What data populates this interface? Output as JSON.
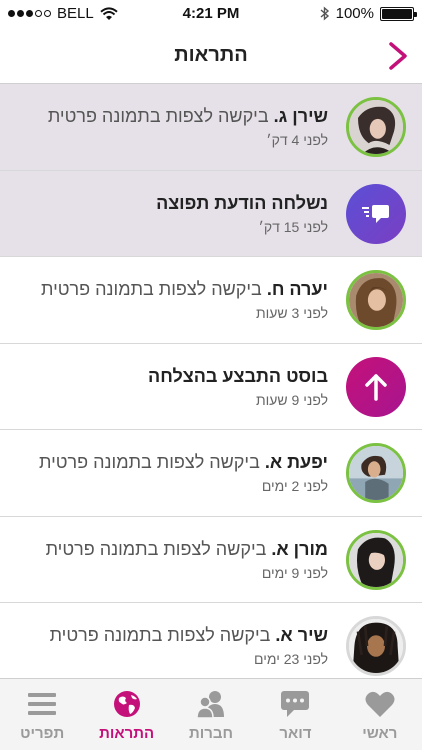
{
  "status_bar": {
    "carrier": "BELL",
    "time": "4:21 PM",
    "battery": "100%",
    "battery_level": 1.0,
    "signal_bars": 3,
    "signal_total": 5
  },
  "header": {
    "title": "התראות"
  },
  "notifications": [
    {
      "name": "שירן ג.",
      "message": " ביקשה לצפות בתמונה פרטית",
      "time": "לפני 4 דק׳",
      "kind": "photo",
      "unread": true
    },
    {
      "name": "",
      "message": "נשלחה הודעת תפוצה",
      "time": "לפני 15 דק׳",
      "kind": "broadcast",
      "unread": true
    },
    {
      "name": "יערה ח.",
      "message": " ביקשה לצפות בתמונה פרטית",
      "time": "לפני 3 שעות",
      "kind": "photo",
      "unread": false
    },
    {
      "name": "",
      "message": "בוסט התבצע בהצלחה",
      "time": "לפני 9 שעות",
      "kind": "boost",
      "unread": false
    },
    {
      "name": "יפעת א.",
      "message": " ביקשה לצפות בתמונה פרטית",
      "time": "לפני 2 ימים",
      "kind": "photo",
      "unread": false
    },
    {
      "name": "מורן א.",
      "message": " ביקשה לצפות בתמונה פרטית",
      "time": "לפני 9 ימים",
      "kind": "photo",
      "unread": false
    },
    {
      "name": "שיר א.",
      "message": " ביקשה לצפות בתמונה פרטית",
      "time": "לפני 23 ימים",
      "kind": "photo",
      "unread": false
    }
  ],
  "tabs": [
    {
      "label": "תפריט",
      "icon": "menu-icon",
      "active": false
    },
    {
      "label": "התראות",
      "icon": "globe-icon",
      "active": true
    },
    {
      "label": "חברות",
      "icon": "friends-icon",
      "active": false
    },
    {
      "label": "דואר",
      "icon": "mail-icon",
      "active": false
    },
    {
      "label": "ראשי",
      "icon": "heart-icon",
      "active": false
    }
  ],
  "colors": {
    "accent": "#c4117a",
    "avatar_ring": "#7bc142",
    "unread_bg": "#e6e1e8",
    "tab_inactive": "#9a9a9a"
  }
}
